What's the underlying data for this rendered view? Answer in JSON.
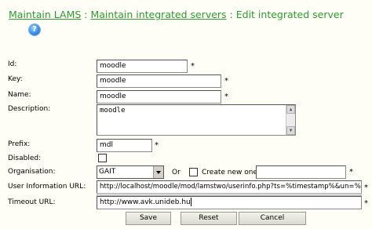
{
  "breadcrumb": {
    "item1": "Maintain LAMS",
    "sep1": ":",
    "item2": "Maintain integrated servers",
    "sep2": ":",
    "current": "Edit integrated server"
  },
  "help_icon": "question-mark-icon",
  "colors": {
    "breadcrumb": "#2f9a2f",
    "background": "#fefef6"
  },
  "required_marker": "*",
  "form": {
    "id": {
      "label": "Id:",
      "value": "moodle"
    },
    "key": {
      "label": "Key:",
      "value": "moodle"
    },
    "name": {
      "label": "Name:",
      "value": "moodle"
    },
    "description": {
      "label": "Description:",
      "value": "moodle"
    },
    "prefix": {
      "label": "Prefix:",
      "value": "mdl"
    },
    "disabled": {
      "label": "Disabled:",
      "checked": false
    },
    "organisation": {
      "label": "Organisation:",
      "selected": "GAIT",
      "or_text": "Or",
      "create_new_label": "Create new one",
      "create_new_checked": false,
      "new_value": ""
    },
    "user_info_url": {
      "label": "User Information URL:",
      "value": "http://localhost/moodle/mod/lamstwo/userinfo.php?ts=%timestamp%&un=%us"
    },
    "timeout_url": {
      "label": "Timeout URL:",
      "value": "http://www.avk.unideb.hu"
    }
  },
  "buttons": {
    "save": "Save",
    "reset": "Reset",
    "cancel": "Cancel"
  }
}
